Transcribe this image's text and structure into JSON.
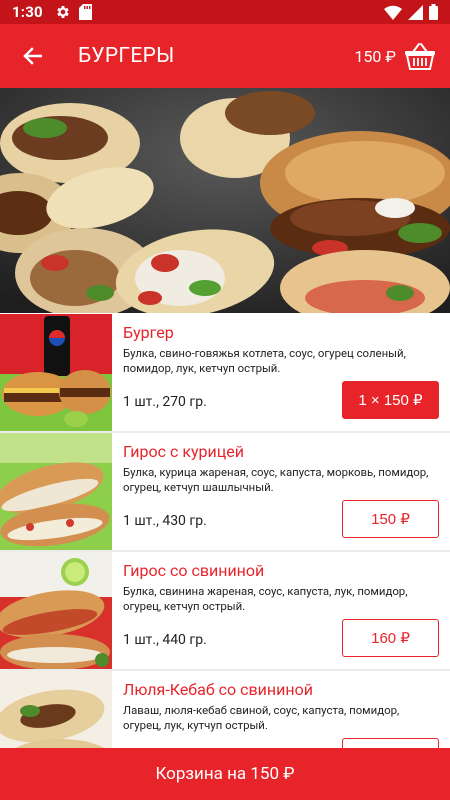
{
  "status_bar": {
    "time": "1:30"
  },
  "toolbar": {
    "title": "БУРГЕРЫ",
    "cart_total": "150 ₽"
  },
  "products": [
    {
      "name": "Бургер",
      "description": "Булка, свино-говяжья котлета, соус, огурец соленый, помидор, лук, кетчуп острый.",
      "weight": "1 шт., 270 гр.",
      "price_label": "1 × 150 ₽",
      "in_cart": true
    },
    {
      "name": "Гирос с курицей",
      "description": "Булка, курица жареная, соус, капуста, морковь, помидор, огурец, кетчуп шашлычный.",
      "weight": "1 шт., 430 гр.",
      "price_label": "150 ₽",
      "in_cart": false
    },
    {
      "name": "Гирос со свининой",
      "description": "Булка, свинина жареная, соус, капуста, лук, помидор, огурец, кетчуп острый.",
      "weight": "1 шт., 440 гр.",
      "price_label": "160 ₽",
      "in_cart": false
    },
    {
      "name": "Люля-Кебаб со свининой",
      "description": "Лаваш, люля-кебаб свиной, соус, капуста, помидор, огурец, лук, кутчуп острый.",
      "weight": "",
      "price_label": "",
      "in_cart": false
    }
  ],
  "cart_bar": {
    "label": "Корзина на 150 ₽"
  },
  "colors": {
    "accent": "#e8242b",
    "status_bar": "#c3141a"
  },
  "icons": {
    "back": "arrow-back-icon",
    "cart": "basket-icon",
    "settings": "gear-icon",
    "sd_card": "sd-card-icon",
    "wifi": "wifi-icon",
    "signal": "signal-icon",
    "battery": "battery-icon"
  }
}
